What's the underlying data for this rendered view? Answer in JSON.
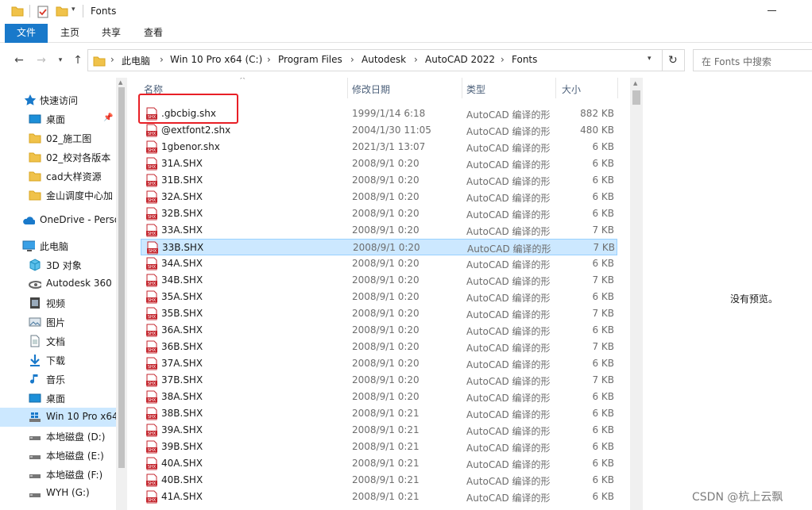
{
  "window": {
    "title": "Fonts"
  },
  "ribbon": {
    "tabs": [
      "文件",
      "主页",
      "共享",
      "查看"
    ]
  },
  "address": {
    "crumbs": [
      "此电脑",
      "Win 10 Pro x64 (C:)",
      "Program Files",
      "Autodesk",
      "AutoCAD 2022",
      "Fonts"
    ],
    "search_placeholder": "在 Fonts 中搜索"
  },
  "nav": {
    "items": [
      {
        "label": "快速访问",
        "icon": "star-icon"
      },
      {
        "label": "桌面",
        "icon": "desktop-icon",
        "pinned": true
      },
      {
        "label": "02_施工图",
        "icon": "folder-icon"
      },
      {
        "label": "02_校对各版本",
        "icon": "folder-icon"
      },
      {
        "label": "cad大样资源",
        "icon": "folder-icon"
      },
      {
        "label": "金山调度中心加",
        "icon": "folder-icon"
      },
      {
        "label": "OneDrive - Perso",
        "icon": "cloud-icon"
      },
      {
        "label": "此电脑",
        "icon": "computer-icon"
      },
      {
        "label": "3D 对象",
        "icon": "cube-icon"
      },
      {
        "label": "Autodesk 360",
        "icon": "cloud-drive-icon"
      },
      {
        "label": "视频",
        "icon": "video-icon"
      },
      {
        "label": "图片",
        "icon": "picture-icon"
      },
      {
        "label": "文档",
        "icon": "document-icon"
      },
      {
        "label": "下载",
        "icon": "download-icon"
      },
      {
        "label": "音乐",
        "icon": "music-icon"
      },
      {
        "label": "桌面",
        "icon": "desktop-icon"
      },
      {
        "label": "Win 10 Pro x64",
        "icon": "windows-drive-icon",
        "selected": true
      },
      {
        "label": "本地磁盘 (D:)",
        "icon": "drive-icon"
      },
      {
        "label": "本地磁盘 (E:)",
        "icon": "drive-icon"
      },
      {
        "label": "本地磁盘 (F:)",
        "icon": "drive-icon"
      },
      {
        "label": "WYH (G:)",
        "icon": "drive-icon"
      }
    ]
  },
  "list": {
    "columns": {
      "name": "名称",
      "date": "修改日期",
      "type": "类型",
      "size": "大小"
    },
    "rows": [
      {
        "name": ".gbcbig.shx",
        "date": "1999/1/14 6:18",
        "type": "AutoCAD 编译的形",
        "size": "882 KB"
      },
      {
        "name": "@extfont2.shx",
        "date": "2004/1/30 11:05",
        "type": "AutoCAD 编译的形",
        "size": "480 KB"
      },
      {
        "name": "1gbenor.shx",
        "date": "2021/3/1 13:07",
        "type": "AutoCAD 编译的形",
        "size": "6 KB"
      },
      {
        "name": "31A.SHX",
        "date": "2008/9/1 0:20",
        "type": "AutoCAD 编译的形",
        "size": "6 KB"
      },
      {
        "name": "31B.SHX",
        "date": "2008/9/1 0:20",
        "type": "AutoCAD 编译的形",
        "size": "6 KB"
      },
      {
        "name": "32A.SHX",
        "date": "2008/9/1 0:20",
        "type": "AutoCAD 编译的形",
        "size": "6 KB"
      },
      {
        "name": "32B.SHX",
        "date": "2008/9/1 0:20",
        "type": "AutoCAD 编译的形",
        "size": "6 KB"
      },
      {
        "name": "33A.SHX",
        "date": "2008/9/1 0:20",
        "type": "AutoCAD 编译的形",
        "size": "7 KB"
      },
      {
        "name": "33B.SHX",
        "date": "2008/9/1 0:20",
        "type": "AutoCAD 编译的形",
        "size": "7 KB",
        "selected": true
      },
      {
        "name": "34A.SHX",
        "date": "2008/9/1 0:20",
        "type": "AutoCAD 编译的形",
        "size": "6 KB"
      },
      {
        "name": "34B.SHX",
        "date": "2008/9/1 0:20",
        "type": "AutoCAD 编译的形",
        "size": "7 KB"
      },
      {
        "name": "35A.SHX",
        "date": "2008/9/1 0:20",
        "type": "AutoCAD 编译的形",
        "size": "6 KB"
      },
      {
        "name": "35B.SHX",
        "date": "2008/9/1 0:20",
        "type": "AutoCAD 编译的形",
        "size": "7 KB"
      },
      {
        "name": "36A.SHX",
        "date": "2008/9/1 0:20",
        "type": "AutoCAD 编译的形",
        "size": "6 KB"
      },
      {
        "name": "36B.SHX",
        "date": "2008/9/1 0:20",
        "type": "AutoCAD 编译的形",
        "size": "7 KB"
      },
      {
        "name": "37A.SHX",
        "date": "2008/9/1 0:20",
        "type": "AutoCAD 编译的形",
        "size": "6 KB"
      },
      {
        "name": "37B.SHX",
        "date": "2008/9/1 0:20",
        "type": "AutoCAD 编译的形",
        "size": "7 KB"
      },
      {
        "name": "38A.SHX",
        "date": "2008/9/1 0:20",
        "type": "AutoCAD 编译的形",
        "size": "6 KB"
      },
      {
        "name": "38B.SHX",
        "date": "2008/9/1 0:21",
        "type": "AutoCAD 编译的形",
        "size": "6 KB"
      },
      {
        "name": "39A.SHX",
        "date": "2008/9/1 0:21",
        "type": "AutoCAD 编译的形",
        "size": "6 KB"
      },
      {
        "name": "39B.SHX",
        "date": "2008/9/1 0:21",
        "type": "AutoCAD 编译的形",
        "size": "6 KB"
      },
      {
        "name": "40A.SHX",
        "date": "2008/9/1 0:21",
        "type": "AutoCAD 编译的形",
        "size": "6 KB"
      },
      {
        "name": "40B.SHX",
        "date": "2008/9/1 0:21",
        "type": "AutoCAD 编译的形",
        "size": "6 KB"
      },
      {
        "name": "41A.SHX",
        "date": "2008/9/1 0:21",
        "type": "AutoCAD 编译的形",
        "size": "6 KB"
      }
    ]
  },
  "preview": {
    "empty_text": "没有预览。"
  },
  "watermark": "CSDN @杭上云飘",
  "colors": {
    "accent": "#1979ca",
    "selection": "#cce8ff",
    "highlight_border": "#e81f26",
    "shx_icon": "#c4262e"
  }
}
